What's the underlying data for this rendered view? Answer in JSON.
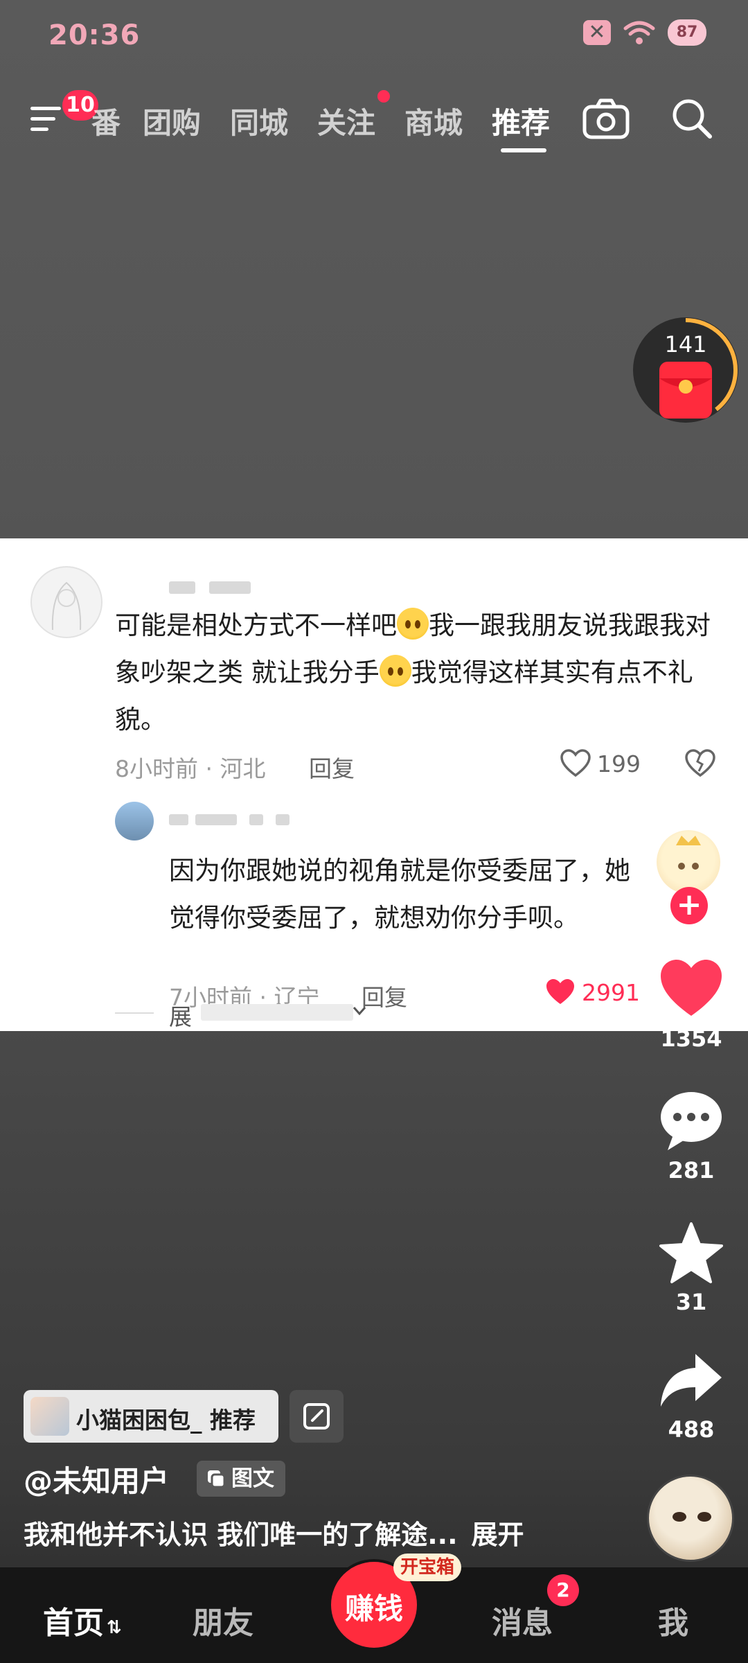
{
  "status_bar": {
    "time": "20:36",
    "battery": "87"
  },
  "top_nav": {
    "menu_badge": "10",
    "tabs": [
      {
        "label": "番"
      },
      {
        "label": "团购"
      },
      {
        "label": "同城"
      },
      {
        "label": "关注"
      },
      {
        "label": "商城"
      },
      {
        "label": "推荐"
      }
    ]
  },
  "red_packet": {
    "count": "141"
  },
  "comments": {
    "main": {
      "text_parts": [
        "可能是相处方式不一样吧",
        "我一跟我朋友说我跟我对象吵架之类 就让我分手",
        "我觉得这样其实有点不礼貌。"
      ],
      "time_location": "8小时前 · 河北",
      "reply_label": "回复",
      "likes": "199"
    },
    "reply": {
      "text": "因为你跟她说的视角就是你受委屈了，她觉得你受委屈了，就想劝你分手呗。",
      "time_location": "7小时前 · 辽宁",
      "reply_label": "回复",
      "likes": "2991"
    },
    "expand_label": "展"
  },
  "actions": {
    "likes": "1354",
    "comments": "281",
    "favorites": "31",
    "shares": "488"
  },
  "post": {
    "recommend_chip": "小猫困困包_ 推荐",
    "author": "@未知用户",
    "type_tag": "图文",
    "description": "我和他并不认识 我们唯一的了解途...",
    "expand": "展开"
  },
  "bottom_nav": {
    "home": "首页",
    "friends": "朋友",
    "earn": "赚钱",
    "earn_tag": "开宝箱",
    "messages": "消息",
    "messages_badge": "2",
    "me": "我"
  },
  "colors": {
    "accent": "#ff2d55",
    "status_pink": "#f2a8b8",
    "panel_bg": "#ffffff"
  }
}
